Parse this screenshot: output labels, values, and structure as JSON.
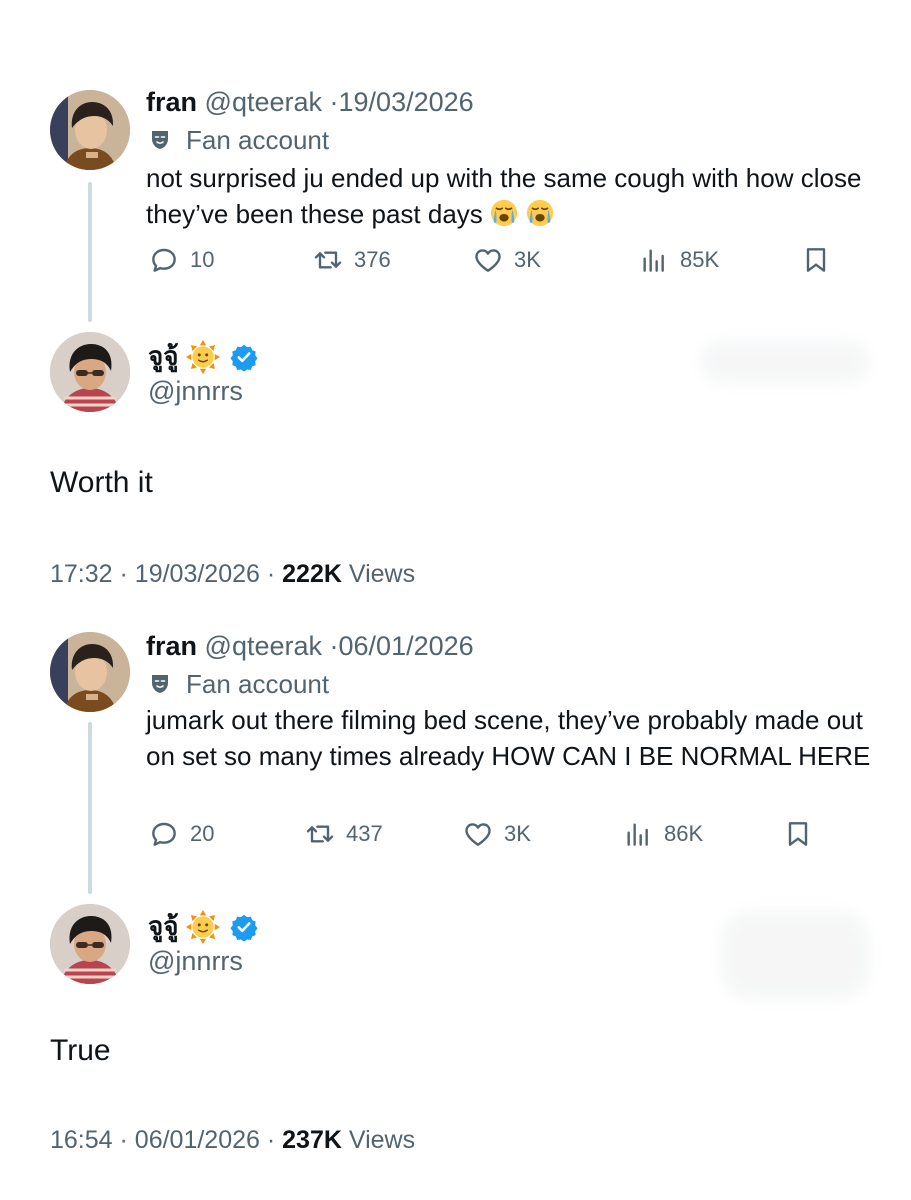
{
  "threads": [
    {
      "quoted": {
        "name": "fran",
        "handle": "@qteerak",
        "separator": "·",
        "date": "19/03/2026",
        "label": "Fan account",
        "text": "not surprised ju ended up with the same cough with how close they’ve been these past days",
        "emojis": [
          "loudly-crying-face",
          "loudly-crying-face"
        ],
        "replies": "10",
        "reposts": "376",
        "likes": "3K",
        "views": "85K"
      },
      "reply": {
        "name": "จูจู้",
        "name_emoji": "sun-with-face",
        "verified": true,
        "handle": "@jnnrrs",
        "text": "Worth it",
        "time": "17:32",
        "separator": "·",
        "date": "19/03/2026",
        "views_count": "222K",
        "views_label": "Views"
      }
    },
    {
      "quoted": {
        "name": "fran",
        "handle": "@qteerak",
        "separator": "·",
        "date": "06/01/2026",
        "label": "Fan account",
        "text": "jumark out there filming bed scene, they’ve probably made out on set so many times already HOW CAN I BE NORMAL HERE",
        "replies": "20",
        "reposts": "437",
        "likes": "3K",
        "views": "86K"
      },
      "reply": {
        "name": "จูจู้",
        "name_emoji": "sun-with-face",
        "verified": true,
        "handle": "@jnnrrs",
        "text": "True",
        "time": "16:54",
        "separator": "·",
        "date": "06/01/2026",
        "views_count": "237K",
        "views_label": "Views"
      }
    }
  ],
  "colors": {
    "text_primary": "#0f1419",
    "text_secondary": "#536471",
    "thread_line": "#cfd9de",
    "verified_blue": "#1d9bf0"
  }
}
